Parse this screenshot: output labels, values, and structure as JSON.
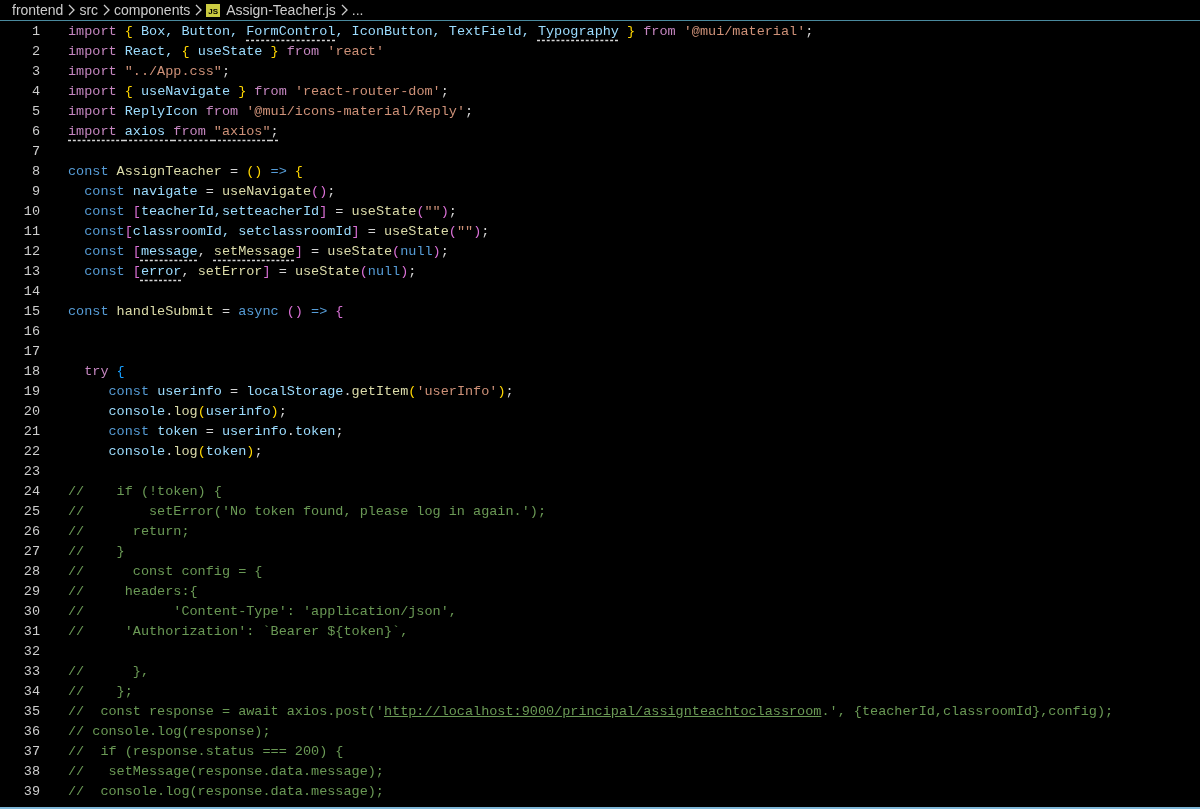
{
  "breadcrumb": {
    "items": [
      {
        "kind": "folder",
        "text": "frontend"
      },
      {
        "kind": "folder",
        "text": "src"
      },
      {
        "kind": "folder",
        "text": "components"
      },
      {
        "kind": "file",
        "text": "Assign-Teacher.js",
        "badge": "JS"
      },
      {
        "kind": "more",
        "text": "..."
      }
    ]
  },
  "editor": {
    "lines": [
      {
        "number": "1",
        "tokens": [
          {
            "text": "import ",
            "kind": "ctrl"
          },
          {
            "text": "{",
            "kind": "b1"
          },
          {
            "text": " Box, Button, ",
            "kind": "var"
          },
          {
            "text": "FormControl",
            "kind": "var",
            "warning": true
          },
          {
            "text": ", IconButton, TextField, ",
            "kind": "var"
          },
          {
            "text": "Typography",
            "kind": "var",
            "warning": true
          },
          {
            "text": " }",
            "kind": "b1"
          },
          {
            "text": " from ",
            "kind": "ctrl"
          },
          {
            "text": "'@mui/material'",
            "kind": "str"
          },
          {
            "text": ";",
            "kind": "p"
          }
        ]
      },
      {
        "number": "2",
        "tokens": [
          {
            "text": "import ",
            "kind": "ctrl"
          },
          {
            "text": "React, ",
            "kind": "var"
          },
          {
            "text": "{",
            "kind": "b1"
          },
          {
            "text": " useState ",
            "kind": "var"
          },
          {
            "text": "}",
            "kind": "b1"
          },
          {
            "text": " from ",
            "kind": "ctrl"
          },
          {
            "text": "'react'",
            "kind": "str"
          }
        ]
      },
      {
        "number": "3",
        "tokens": [
          {
            "text": "import ",
            "kind": "ctrl"
          },
          {
            "text": "\"../App.css\"",
            "kind": "str"
          },
          {
            "text": ";",
            "kind": "p"
          }
        ]
      },
      {
        "number": "4",
        "tokens": [
          {
            "text": "import ",
            "kind": "ctrl"
          },
          {
            "text": "{",
            "kind": "b1"
          },
          {
            "text": " useNavigate ",
            "kind": "var"
          },
          {
            "text": "}",
            "kind": "b1"
          },
          {
            "text": " from ",
            "kind": "ctrl"
          },
          {
            "text": "'react-router-dom'",
            "kind": "str"
          },
          {
            "text": ";",
            "kind": "p"
          }
        ]
      },
      {
        "number": "5",
        "tokens": [
          {
            "text": "import ",
            "kind": "ctrl"
          },
          {
            "text": "ReplyIcon ",
            "kind": "var"
          },
          {
            "text": "from ",
            "kind": "ctrl"
          },
          {
            "text": "'@mui/icons-material/Reply'",
            "kind": "str"
          },
          {
            "text": ";",
            "kind": "p"
          }
        ]
      },
      {
        "number": "6",
        "tokens": [
          {
            "text": "import ",
            "kind": "ctrl",
            "warning": true
          },
          {
            "text": "axios ",
            "kind": "var",
            "warning": true
          },
          {
            "text": "from ",
            "kind": "ctrl",
            "warning": true
          },
          {
            "text": "\"axios\"",
            "kind": "str",
            "warning": true
          },
          {
            "text": ";",
            "kind": "p",
            "warning": true
          }
        ]
      },
      {
        "number": "7"
      },
      {
        "number": "8",
        "tokens": [
          {
            "text": "const ",
            "kind": "kw"
          },
          {
            "text": "AssignTeacher",
            "kind": "fn"
          },
          {
            "text": " = ",
            "kind": "p"
          },
          {
            "text": "()",
            "kind": "b1"
          },
          {
            "text": " => ",
            "kind": "kw"
          },
          {
            "text": "{",
            "kind": "b1"
          }
        ]
      },
      {
        "number": "9",
        "tokens": [
          {
            "text": "  const ",
            "kind": "kw"
          },
          {
            "text": "navigate",
            "kind": "var"
          },
          {
            "text": " = ",
            "kind": "p"
          },
          {
            "text": "useNavigate",
            "kind": "fn"
          },
          {
            "text": "()",
            "kind": "b2"
          },
          {
            "text": ";",
            "kind": "p"
          }
        ]
      },
      {
        "number": "10",
        "tokens": [
          {
            "text": "  const ",
            "kind": "kw"
          },
          {
            "text": "[",
            "kind": "b2"
          },
          {
            "text": "teacherId,setteacherId",
            "kind": "var"
          },
          {
            "text": "]",
            "kind": "b2"
          },
          {
            "text": " = ",
            "kind": "p"
          },
          {
            "text": "useState",
            "kind": "fn"
          },
          {
            "text": "(",
            "kind": "b2"
          },
          {
            "text": "\"\"",
            "kind": "str"
          },
          {
            "text": ")",
            "kind": "b2"
          },
          {
            "text": ";",
            "kind": "p"
          }
        ]
      },
      {
        "number": "11",
        "tokens": [
          {
            "text": "  const",
            "kind": "kw"
          },
          {
            "text": "[",
            "kind": "b2"
          },
          {
            "text": "classroomId, setclassroomId",
            "kind": "var"
          },
          {
            "text": "]",
            "kind": "b2"
          },
          {
            "text": " = ",
            "kind": "p"
          },
          {
            "text": "useState",
            "kind": "fn"
          },
          {
            "text": "(",
            "kind": "b2"
          },
          {
            "text": "\"\"",
            "kind": "str"
          },
          {
            "text": ")",
            "kind": "b2"
          },
          {
            "text": ";",
            "kind": "p"
          }
        ]
      },
      {
        "number": "12",
        "tokens": [
          {
            "text": "  const ",
            "kind": "kw"
          },
          {
            "text": "[",
            "kind": "b2"
          },
          {
            "text": "message",
            "kind": "var",
            "warning": true
          },
          {
            "text": ", ",
            "kind": "p"
          },
          {
            "text": "setMessage",
            "kind": "fn",
            "warning": true
          },
          {
            "text": "]",
            "kind": "b2"
          },
          {
            "text": " = ",
            "kind": "p"
          },
          {
            "text": "useState",
            "kind": "fn"
          },
          {
            "text": "(",
            "kind": "b2"
          },
          {
            "text": "null",
            "kind": "kw"
          },
          {
            "text": ")",
            "kind": "b2"
          },
          {
            "text": ";",
            "kind": "p"
          }
        ]
      },
      {
        "number": "13",
        "tokens": [
          {
            "text": "  const ",
            "kind": "kw"
          },
          {
            "text": "[",
            "kind": "b2"
          },
          {
            "text": "error",
            "kind": "var",
            "warning": true
          },
          {
            "text": ", ",
            "kind": "p"
          },
          {
            "text": "setError",
            "kind": "fn"
          },
          {
            "text": "]",
            "kind": "b2"
          },
          {
            "text": " = ",
            "kind": "p"
          },
          {
            "text": "useState",
            "kind": "fn"
          },
          {
            "text": "(",
            "kind": "b2"
          },
          {
            "text": "null",
            "kind": "kw"
          },
          {
            "text": ")",
            "kind": "b2"
          },
          {
            "text": ";",
            "kind": "p"
          }
        ]
      },
      {
        "number": "14"
      },
      {
        "number": "15",
        "tokens": [
          {
            "text": "const ",
            "kind": "kw"
          },
          {
            "text": "handleSubmit",
            "kind": "fn"
          },
          {
            "text": " = ",
            "kind": "p"
          },
          {
            "text": "async ",
            "kind": "kw"
          },
          {
            "text": "()",
            "kind": "b2"
          },
          {
            "text": " => ",
            "kind": "kw"
          },
          {
            "text": "{",
            "kind": "b2"
          }
        ]
      },
      {
        "number": "16"
      },
      {
        "number": "17"
      },
      {
        "number": "18",
        "tokens": [
          {
            "text": "  try ",
            "kind": "ctrl"
          },
          {
            "text": "{",
            "kind": "b3"
          }
        ]
      },
      {
        "number": "19",
        "tokens": [
          {
            "text": "     const ",
            "kind": "kw"
          },
          {
            "text": "userinfo",
            "kind": "var"
          },
          {
            "text": " = ",
            "kind": "p"
          },
          {
            "text": "localStorage",
            "kind": "var"
          },
          {
            "text": ".",
            "kind": "p"
          },
          {
            "text": "getItem",
            "kind": "fn"
          },
          {
            "text": "(",
            "kind": "b1"
          },
          {
            "text": "'userInfo'",
            "kind": "str"
          },
          {
            "text": ")",
            "kind": "b1"
          },
          {
            "text": ";",
            "kind": "p"
          }
        ]
      },
      {
        "number": "20",
        "tokens": [
          {
            "text": "     console",
            "kind": "var"
          },
          {
            "text": ".",
            "kind": "p"
          },
          {
            "text": "log",
            "kind": "fn"
          },
          {
            "text": "(",
            "kind": "b1"
          },
          {
            "text": "userinfo",
            "kind": "var"
          },
          {
            "text": ")",
            "kind": "b1"
          },
          {
            "text": ";",
            "kind": "p"
          }
        ]
      },
      {
        "number": "21",
        "tokens": [
          {
            "text": "     const ",
            "kind": "kw"
          },
          {
            "text": "token",
            "kind": "var"
          },
          {
            "text": " = ",
            "kind": "p"
          },
          {
            "text": "userinfo",
            "kind": "var"
          },
          {
            "text": ".",
            "kind": "p"
          },
          {
            "text": "token",
            "kind": "var"
          },
          {
            "text": ";",
            "kind": "p"
          }
        ]
      },
      {
        "number": "22",
        "tokens": [
          {
            "text": "     console",
            "kind": "var"
          },
          {
            "text": ".",
            "kind": "p"
          },
          {
            "text": "log",
            "kind": "fn"
          },
          {
            "text": "(",
            "kind": "b1"
          },
          {
            "text": "token",
            "kind": "var"
          },
          {
            "text": ")",
            "kind": "b1"
          },
          {
            "text": ";",
            "kind": "p"
          }
        ]
      },
      {
        "number": "23"
      },
      {
        "number": "24",
        "tokens": [
          {
            "text": "//    if (!token) {",
            "kind": "comment"
          }
        ]
      },
      {
        "number": "25",
        "tokens": [
          {
            "text": "//        setError('No token found, please log in again.');",
            "kind": "comment"
          }
        ]
      },
      {
        "number": "26",
        "tokens": [
          {
            "text": "//      return;",
            "kind": "comment"
          }
        ]
      },
      {
        "number": "27",
        "tokens": [
          {
            "text": "//    }",
            "kind": "comment"
          }
        ]
      },
      {
        "number": "28",
        "tokens": [
          {
            "text": "//      const config = {",
            "kind": "comment"
          }
        ]
      },
      {
        "number": "29",
        "tokens": [
          {
            "text": "//     headers:{",
            "kind": "comment"
          }
        ]
      },
      {
        "number": "30",
        "tokens": [
          {
            "text": "//           'Content-Type': 'application/json',",
            "kind": "comment"
          }
        ]
      },
      {
        "number": "31",
        "tokens": [
          {
            "text": "//     'Authorization': `Bearer ${token}`,",
            "kind": "comment"
          }
        ]
      },
      {
        "number": "32"
      },
      {
        "number": "33",
        "tokens": [
          {
            "text": "//      },",
            "kind": "comment"
          }
        ]
      },
      {
        "number": "34",
        "tokens": [
          {
            "text": "//    };",
            "kind": "comment"
          }
        ]
      },
      {
        "number": "35",
        "tokens": [
          {
            "text": "//  const response = await axios.post('",
            "kind": "comment"
          },
          {
            "text": "http://localhost:9000/principal/assignteachtoclassroom",
            "kind": "link"
          },
          {
            "text": ".', {teacherId,classroomId},config);",
            "kind": "comment"
          }
        ]
      },
      {
        "number": "36",
        "tokens": [
          {
            "text": "// console.log(response);",
            "kind": "comment"
          }
        ]
      },
      {
        "number": "37",
        "tokens": [
          {
            "text": "//  if (response.status === 200) {",
            "kind": "comment"
          }
        ]
      },
      {
        "number": "38",
        "tokens": [
          {
            "text": "//   setMessage(response.data.message);",
            "kind": "comment"
          }
        ]
      },
      {
        "number": "39",
        "tokens": [
          {
            "text": "//  console.log(response.data.message);",
            "kind": "comment"
          }
        ]
      }
    ]
  }
}
